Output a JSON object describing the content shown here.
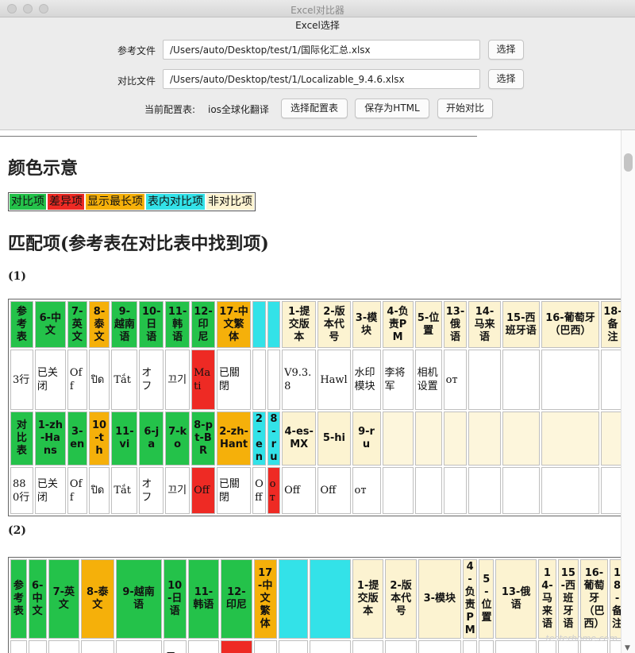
{
  "window": {
    "title": "Excel对比器"
  },
  "panel": {
    "title": "Excel选择",
    "ref_label": "参考文件",
    "ref_path": "/Users/auto/Desktop/test/1/国际化汇总.xlsx",
    "cmp_label": "对比文件",
    "cmp_path": "/Users/auto/Desktop/test/1/Localizable_9.4.6.xlsx",
    "choose_label": "选择",
    "config_label": "当前配置表:",
    "config_value": "ios全球化翻译",
    "choose_config_label": "选择配置表",
    "save_html_label": "保存为HTML",
    "start_compare_label": "开始对比"
  },
  "report": {
    "color_heading": "颜色示意",
    "legend": [
      "对比项",
      "差异项",
      "显示最长项",
      "表内对比项",
      "非对比项"
    ],
    "match_heading": "匹配项(参考表在对比表中找到项)",
    "sections": [
      {
        "label": "(1)",
        "ref_header": [
          "参考表",
          "6-中文",
          "7-英文",
          "8-泰文",
          "9-越南语",
          "10-日语",
          "11-韩语",
          "12-印尼",
          "17-中文繁体",
          "",
          "",
          "1-提交版本",
          "2-版本代号",
          "3-模块",
          "4-负责PM",
          "5-位置",
          "13-俄语",
          "14-马来语",
          "15-西班牙语",
          "16-葡萄牙（巴西）",
          "18-备注"
        ],
        "ref_row": [
          "3行",
          "已关闭",
          "Off",
          "ปิด",
          "Tắt",
          "オフ",
          "끄기",
          "Mati",
          "已關閉",
          "",
          "",
          "V9.3.8",
          "Hawl",
          "水印模块",
          "李将军",
          "相机设置",
          "от",
          "",
          "",
          "",
          ""
        ],
        "cmp_header": [
          "对比表",
          "1-zh-Hans",
          "3-en",
          "10-th",
          "11-vi",
          "6-ja",
          "7-ko",
          "8-pt-BR",
          "2-zh-Hant",
          "2-en",
          "8-ru",
          "4-es-MX",
          "5-hi",
          "9-ru",
          "",
          "",
          "",
          "",
          "",
          "",
          ""
        ],
        "cmp_row": [
          "880行",
          "已关闭",
          "Off",
          "ปิด",
          "Tắt",
          "オフ",
          "끄기",
          "Off",
          "已關閉",
          "Off",
          "от",
          "Off",
          "Off",
          "от",
          "",
          "",
          "",
          "",
          "",
          "",
          ""
        ]
      },
      {
        "label": "(2)",
        "ref_header": [
          "参考表",
          "6-中文",
          "7-英文",
          "8-泰文",
          "9-越南语",
          "10-日语",
          "11-韩语",
          "12-印尼",
          "17-中文繁体",
          "",
          "",
          "1-提交版本",
          "2-版本代号",
          "3-模块",
          "4-负责PM",
          "5-位置",
          "13-俄语",
          "14-马来语",
          "15-西班牙语",
          "16-葡萄牙（巴西）",
          "18-备注"
        ],
        "ref_row_partial": [
          "",
          "",
          "",
          "",
          "",
          "ロ",
          "",
          "",
          "",
          "",
          "",
          "",
          "",
          "",
          "",
          "",
          "",
          "",
          "",
          "",
          ""
        ]
      }
    ]
  },
  "colors": {
    "compare": "#24c24a",
    "diff": "#ee2a24",
    "longest": "#f5b00a",
    "intable": "#33e2e8",
    "noncompare": "#fcf3d1"
  },
  "watermark": "testerhome.com"
}
